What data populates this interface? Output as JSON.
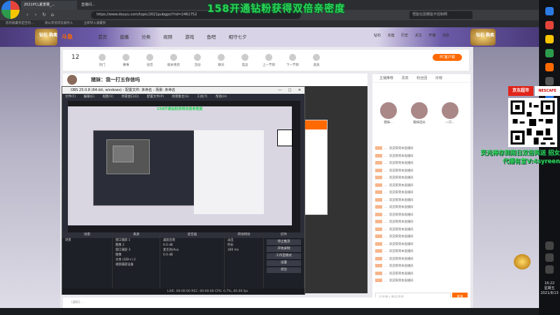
{
  "overlay_title": "158开通钻粉获得双倍亲密度",
  "browser": {
    "tabs": [
      "2021PCL夏季赛_...",
      "直播间..."
    ],
    "url": "https://www.douyu.com/topic/2021pubgpcl?rid=2461752",
    "search_placeholder": "悟能社团哪能不控制啊",
    "bookmarks": [
      "您的收藏夹是空的...",
      "请从其他浏览器导入",
      "立即导入收藏夹"
    ]
  },
  "site": {
    "logo": "斗鱼",
    "nav": [
      "首页",
      "直播",
      "分类",
      "视频",
      "游戏",
      "鱼吧",
      "相守七夕"
    ],
    "banner_left": "钻石\n购卖",
    "banner_right": "钻石\n购卖",
    "header_icons": [
      "钻石",
      "充值",
      "历史",
      "关注",
      "开播",
      "消息"
    ]
  },
  "category": {
    "number": "12",
    "items": [
      "热门",
      "赛事",
      "语音",
      "版本更新",
      "活动",
      "聊天",
      "电竞",
      "上一节目",
      "下一节目",
      "道具"
    ],
    "pc_button": "PC客户端"
  },
  "stream": {
    "title": "猪妹：我一打五你信吗"
  },
  "obs": {
    "title": "OBS 25.0.8 (64-bit, windows) - 配置文件: 未命名 - 场景: 未命名",
    "menu": [
      "文件(F)",
      "编辑(E)",
      "视图(V)",
      "停靠窗口(D)",
      "配置文件(P)",
      "场景集合(S)",
      "工具(T)",
      "帮助(H)"
    ],
    "nested_title": "158开通钻粉获得双倍亲密度",
    "docks": {
      "scenes_header": "场景",
      "scenes": [
        "场景"
      ],
      "sources_header": "来源",
      "sources": [
        "窗口捕获 1",
        "图像 2",
        "窗口捕获 3",
        "图像",
        "文本 (GDI+) 2",
        "视频捕获设备"
      ],
      "mixer_header": "混音器",
      "mixer": [
        "桌面音频",
        "0.0 dB",
        "麦克风/Aux",
        "0.0 dB"
      ],
      "transitions_header": "转场特效",
      "transition_value": "淡出",
      "duration_label": "时长",
      "duration_value": "300 ms",
      "controls_header": "控件",
      "controls": [
        "停止推流",
        "开始录制",
        "工作室模式",
        "设置",
        "退出"
      ]
    },
    "status": "LIVE: 00:00:00   REC: 00:00:00   CPU: 0.7%, 60.00 fps"
  },
  "chat": {
    "tabs": [
      "主播推荐",
      "贵宾",
      "粉丝团",
      "日榜"
    ],
    "fans": [
      "猪妹...",
      "猪妹团长",
      "一只..."
    ],
    "messages": [
      {
        "name": "...",
        "text": "欢迎来到本直播间"
      },
      {
        "name": "...",
        "text": "欢迎来到本直播间"
      },
      {
        "name": "...",
        "text": "欢迎来到本直播间"
      },
      {
        "name": "...",
        "text": "欢迎来到本直播间"
      },
      {
        "name": "...",
        "text": "欢迎来到本直播间"
      },
      {
        "name": "...",
        "text": "欢迎来到本直播间"
      },
      {
        "name": "...",
        "text": "欢迎来到本直播间"
      },
      {
        "name": "...",
        "text": "欢迎来到本直播间"
      },
      {
        "name": "...",
        "text": "欢迎来到本直播间"
      },
      {
        "name": "...",
        "text": "欢迎来到本直播间"
      },
      {
        "name": "...",
        "text": "欢迎来到本直播间"
      },
      {
        "name": "...",
        "text": "欢迎来到本直播间"
      },
      {
        "name": "...",
        "text": "欢迎来到本直播间"
      },
      {
        "name": "...",
        "text": "欢迎来到本直播间"
      },
      {
        "name": "...",
        "text": "欢迎来到本直播间"
      },
      {
        "name": "...",
        "text": "欢迎来到本直播间"
      },
      {
        "name": "...",
        "text": "欢迎来到本直播间"
      },
      {
        "name": "...",
        "text": "欢迎来到本直播间"
      },
      {
        "name": "...",
        "text": "欢迎来到本直播间"
      }
    ],
    "input_placeholder": "这里输入聊天内容",
    "send": "发送"
  },
  "bottombar": "[通知] ...",
  "ad": {
    "logo": "京东超市",
    "logo2": "NESCAFE",
    "text": "荧光棒存到周日双倍再送 招女代播有意V:4syreen"
  },
  "clock": {
    "time": "16:22",
    "day": "星期五",
    "date": "2021/8/13"
  }
}
